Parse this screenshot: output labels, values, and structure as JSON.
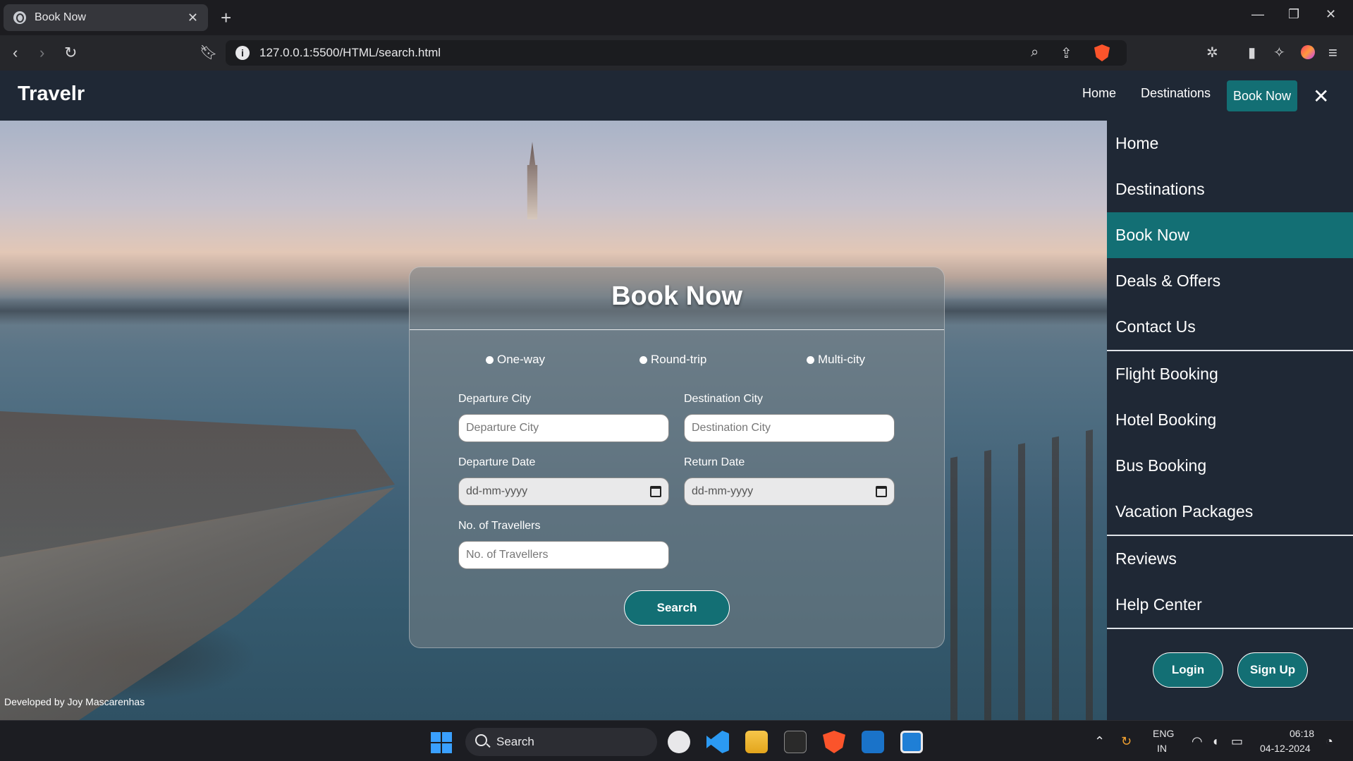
{
  "browser": {
    "tab_title": "Book Now",
    "url": "127.0.0.1:5500/HTML/search.html"
  },
  "site": {
    "brand": "Travelr",
    "nav": {
      "home": "Home",
      "destinations": "Destinations",
      "book_now": "Book Now"
    },
    "credit": "Developed by Joy Mascarenhas"
  },
  "booking": {
    "title": "Book Now",
    "trip_types": [
      "One-way",
      "Round-trip",
      "Multi-city"
    ],
    "departure_city": {
      "label": "Departure City",
      "placeholder": "Departure City"
    },
    "destination_city": {
      "label": "Destination City",
      "placeholder": "Destination City"
    },
    "departure_date": {
      "label": "Departure Date",
      "placeholder": "dd-mm-yyyy"
    },
    "return_date": {
      "label": "Return Date",
      "placeholder": "dd-mm-yyyy"
    },
    "travellers": {
      "label": "No. of Travellers",
      "placeholder": "No. of Travellers"
    },
    "search_label": "Search"
  },
  "side_menu": {
    "items": [
      "Home",
      "Destinations",
      "Book Now",
      "Deals & Offers",
      "Contact Us",
      "Flight Booking",
      "Hotel Booking",
      "Bus Booking",
      "Vacation Packages",
      "Reviews",
      "Help Center"
    ],
    "active": "Book Now",
    "login": "Login",
    "signup": "Sign Up"
  },
  "taskbar": {
    "search_text": "Search",
    "lang_1": "ENG",
    "lang_2": "IN",
    "time": "06:18",
    "date": "04-12-2024"
  },
  "colors": {
    "accent": "#136f74",
    "nav_bg": "#1f2835"
  }
}
